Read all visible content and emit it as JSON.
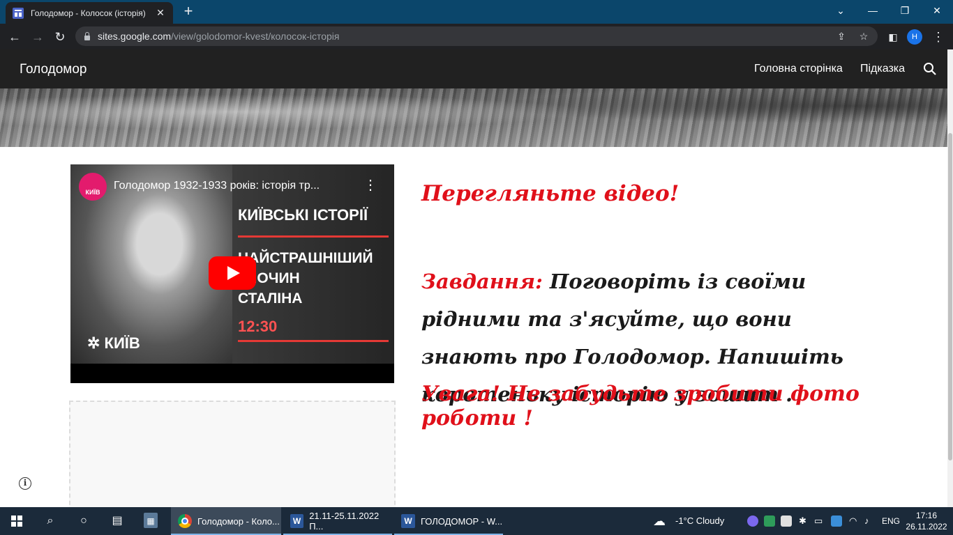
{
  "browser": {
    "tab_title": "Голодомор - Колосок (історія)",
    "tab_close": "✕",
    "new_tab": "+",
    "url_host": "sites.google.com",
    "url_path": "/view/golodomor-kvest/колосок-історія",
    "profile_initial": "Н",
    "window_controls": {
      "dropdown": "⌄",
      "minimize": "—",
      "restore": "❐",
      "close": "✕"
    },
    "nav": {
      "back": "←",
      "forward": "→",
      "reload": "↻"
    }
  },
  "site": {
    "title": "Голодомор",
    "nav": [
      "Головна сторінка",
      "Підказка"
    ]
  },
  "video": {
    "channel_label": "КИЇВ",
    "title": "Голодомор 1932-1933 років: історія тр...",
    "menu": "⋮",
    "heading": "КИЇВСЬКІ ІСТОРІЇ",
    "subheading": "НАЙСТРАШНІШИЙ\nЗЛОЧИН\nСТАЛІНА",
    "duration": "12:30",
    "logo_text": "КИЇВ"
  },
  "content": {
    "watch": "Перегляньте відео!",
    "task_label": "Завдання:",
    "task_text": " Поговоріть із своїми рідними та з'ясуйте, що вони знають про Голодомор. Напишіть коротеньку історію у зошит .",
    "warning": "Увага! Не забудьте зробити фото роботи !"
  },
  "info_icon": "i",
  "taskbar": {
    "tasks": [
      {
        "label": "Голодомор - Коло...",
        "icon": "chrome-icon"
      },
      {
        "label": "21.11-25.11.2022 П...",
        "icon": "word-icon"
      },
      {
        "label": "ГОЛОДОМОР - W...",
        "icon": "word-icon"
      }
    ],
    "weather": "-1°C  Cloudy",
    "language": "ENG",
    "time": "17:16",
    "date": "26.11.2022"
  },
  "colors": {
    "accent_red": "#e0101a",
    "header_bg": "#212121",
    "youtube_red": "#ff0000"
  }
}
